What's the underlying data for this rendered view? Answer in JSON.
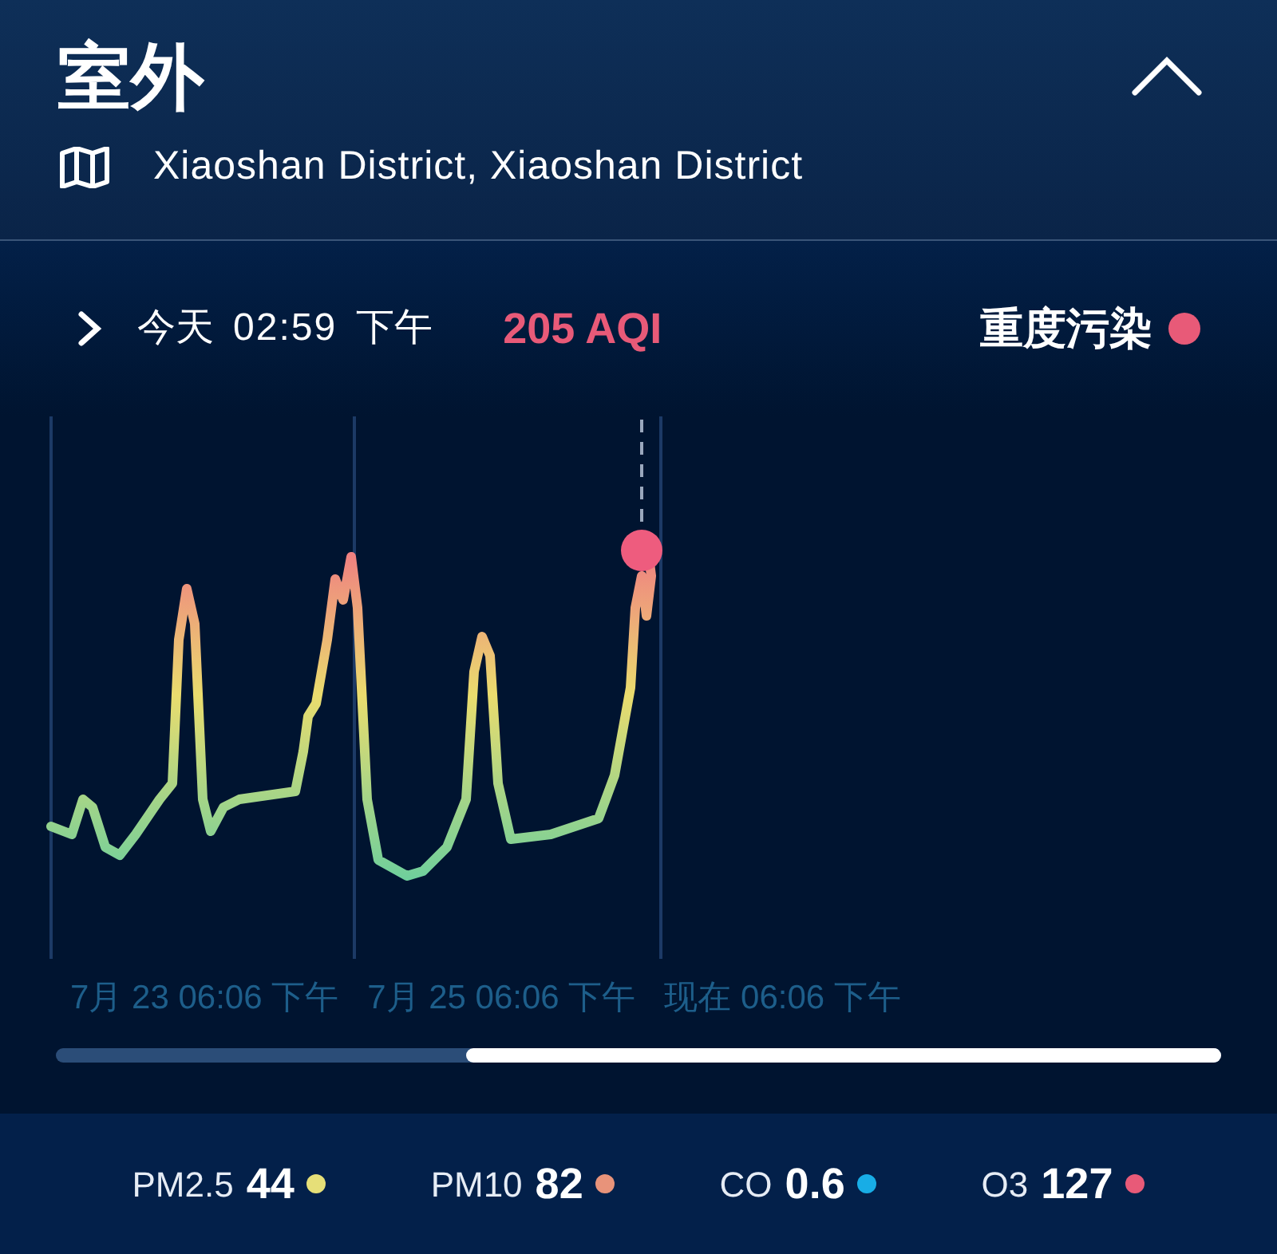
{
  "header": {
    "title": "室外",
    "location": "Xiaoshan District, Xiaoshan District",
    "expanded": true
  },
  "reading": {
    "day": "今天",
    "time": "02:59",
    "period": "下午",
    "aqi": "205 AQI",
    "status": "重度污染",
    "color": "#e85a78"
  },
  "chart": {
    "x_labels": [
      "7月 23 06:06 下午",
      "7月 25 06:06 下午",
      "现在 06:06 下午"
    ]
  },
  "pollutants": [
    {
      "name": "PM2.5",
      "value": "44",
      "color": "#e6df78"
    },
    {
      "name": "PM10",
      "value": "82",
      "color": "#e8937a"
    },
    {
      "name": "CO",
      "value": "0.6",
      "color": "#18ade6"
    },
    {
      "name": "O3",
      "value": "127",
      "color": "#e85a78"
    }
  ]
}
